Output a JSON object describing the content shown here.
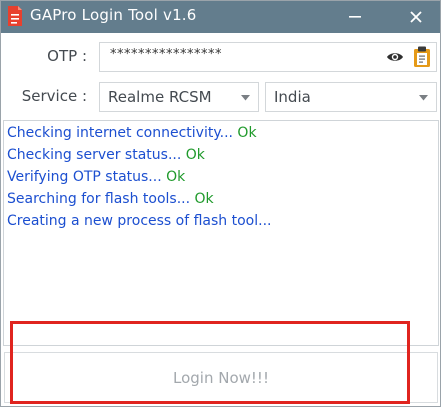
{
  "window": {
    "title": "GAPro Login Tool v1.6",
    "minimize_symbol": "—",
    "close_symbol": "✕"
  },
  "form": {
    "otp_label": "OTP :",
    "otp_value": "****************",
    "service_label": "Service :",
    "service_value": "Realme RCSM",
    "region_value": "India"
  },
  "log": [
    {
      "text": "Checking internet connectivity... ",
      "status": "Ok"
    },
    {
      "text": "Checking server status... ",
      "status": "Ok"
    },
    {
      "text": "Verifying OTP status... ",
      "status": "Ok"
    },
    {
      "text": "Searching for flash tools... ",
      "status": "Ok"
    },
    {
      "text": "Creating a new process of flash tool...",
      "status": ""
    }
  ],
  "login_button": {
    "label": "Login Now!!!"
  },
  "colors": {
    "titlebar": "#637d8d",
    "log_text": "#1c4fd0",
    "log_ok": "#1f9a2b",
    "highlight": "#e0241f"
  },
  "icons": {
    "app": "red-document-icon",
    "show_password": "eye-icon",
    "paste": "clipboard-icon"
  }
}
